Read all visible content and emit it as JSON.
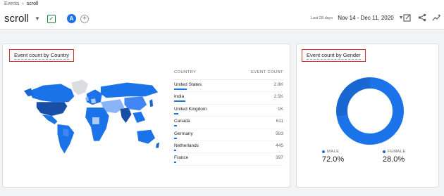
{
  "breadcrumb": {
    "parent": "Events",
    "current": "scroll"
  },
  "header": {
    "title": "scroll",
    "avatar_letter": "A",
    "date_sub": "Last 28 days",
    "date_range": "Nov 14 - Dec 11, 2020"
  },
  "country_card": {
    "title": "Event count by Country",
    "col_country": "COUNTRY",
    "col_count": "EVENT COUNT",
    "rows": [
      {
        "country": "United States",
        "count": "2.8K",
        "share": 1.0
      },
      {
        "country": "India",
        "count": "2.5K",
        "share": 0.89
      },
      {
        "country": "United Kingdom",
        "count": "1K",
        "share": 0.36
      },
      {
        "country": "Canada",
        "count": "611",
        "share": 0.22
      },
      {
        "country": "Germany",
        "count": "593",
        "share": 0.21
      },
      {
        "country": "Netherlands",
        "count": "445",
        "share": 0.16
      },
      {
        "country": "France",
        "count": "397",
        "share": 0.14
      }
    ]
  },
  "gender_card": {
    "title": "Event count by Gender",
    "male_label": "MALE",
    "male_pct": "72.0%",
    "female_label": "FEMALE",
    "female_pct": "28.0%",
    "male_share": 0.72,
    "female_share": 0.28
  },
  "colors": {
    "primary": "#1a73e8",
    "dark": "#174ea6",
    "light": "#8ab4f8",
    "highlight": "#d93025"
  }
}
